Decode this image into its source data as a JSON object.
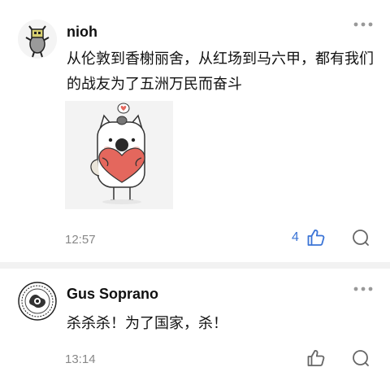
{
  "comments": [
    {
      "username": "nioh",
      "text": "从伦敦到香榭丽舍，从红场到马六甲，都有我们的战友为了五洲万民而奋斗",
      "time": "12:57",
      "likes": "4",
      "liked": true,
      "avatar_icon": "cartoon-character-avatar",
      "sticker_icon": "dog-holding-heart-sticker"
    },
    {
      "username": "Gus Soprano",
      "text": "杀杀杀！为了国家，杀！",
      "time": "13:14",
      "likes": "",
      "liked": false,
      "avatar_icon": "ornate-emblem-avatar"
    }
  ],
  "colors": {
    "accent": "#3b74d6",
    "muted": "#888888",
    "divider": "#f2f2f2"
  }
}
